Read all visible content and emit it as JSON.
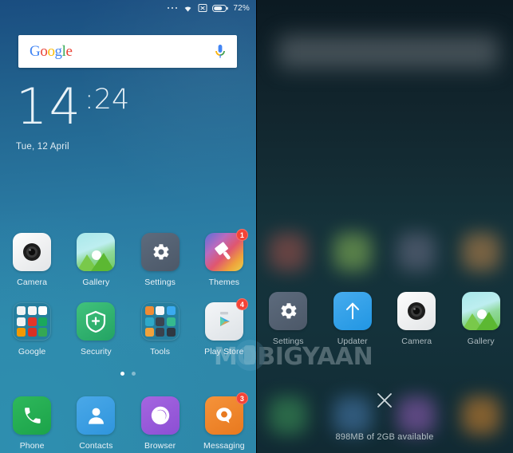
{
  "home": {
    "statusbar": {
      "more_icon": "overflow-dots-icon",
      "wifi_icon": "wifi-icon",
      "sim_icon": "no-sim-icon",
      "battery_icon": "battery-icon",
      "battery_percent": "72%"
    },
    "search": {
      "logo_letters": [
        "G",
        "o",
        "o",
        "g",
        "l",
        "e"
      ],
      "logo_text": "Google",
      "mic_icon": "microphone-icon"
    },
    "clock": {
      "hours": "14",
      "minutes": ":24",
      "date": "Tue, 12 April"
    },
    "rows": [
      [
        {
          "label": "Camera",
          "icon": "camera-icon",
          "badge": ""
        },
        {
          "label": "Gallery",
          "icon": "gallery-icon",
          "badge": ""
        },
        {
          "label": "Settings",
          "icon": "settings-gear-icon",
          "badge": ""
        },
        {
          "label": "Themes",
          "icon": "themes-brush-icon",
          "badge": "1"
        }
      ],
      [
        {
          "label": "Google",
          "icon": "google-folder-icon",
          "badge": ""
        },
        {
          "label": "Security",
          "icon": "security-shield-icon",
          "badge": ""
        },
        {
          "label": "Tools",
          "icon": "tools-folder-icon",
          "badge": ""
        },
        {
          "label": "Play Store",
          "icon": "play-store-icon",
          "badge": "4"
        }
      ]
    ],
    "dock": [
      {
        "label": "Phone",
        "icon": "phone-handset-icon",
        "badge": ""
      },
      {
        "label": "Contacts",
        "icon": "contacts-person-icon",
        "badge": ""
      },
      {
        "label": "Browser",
        "icon": "browser-icon",
        "badge": ""
      },
      {
        "label": "Messaging",
        "icon": "messaging-bubble-icon",
        "badge": "3"
      }
    ],
    "page_indicator": {
      "total": 2,
      "active": 1
    },
    "colors": {
      "bg_top": "#1a4d80",
      "bg_bottom": "#2d87a9",
      "badge_red": "#f44336",
      "label_text": "#eaf2f7"
    }
  },
  "recents": {
    "apps": [
      {
        "label": "Settings",
        "icon": "settings-gear-icon"
      },
      {
        "label": "Updater",
        "icon": "updater-arrow-icon"
      },
      {
        "label": "Camera",
        "icon": "camera-icon"
      },
      {
        "label": "Gallery",
        "icon": "gallery-icon"
      }
    ],
    "close_all_icon": "close-x-icon",
    "memory_status": "898MB of 2GB available",
    "colors": {
      "bg_top": "#0c1a22",
      "bg_mid": "#15323a",
      "label_text": "#aebbc0"
    }
  },
  "watermark": {
    "text": "MOBIGYAAN",
    "logo_icon": "phone-circle-logo-icon"
  }
}
